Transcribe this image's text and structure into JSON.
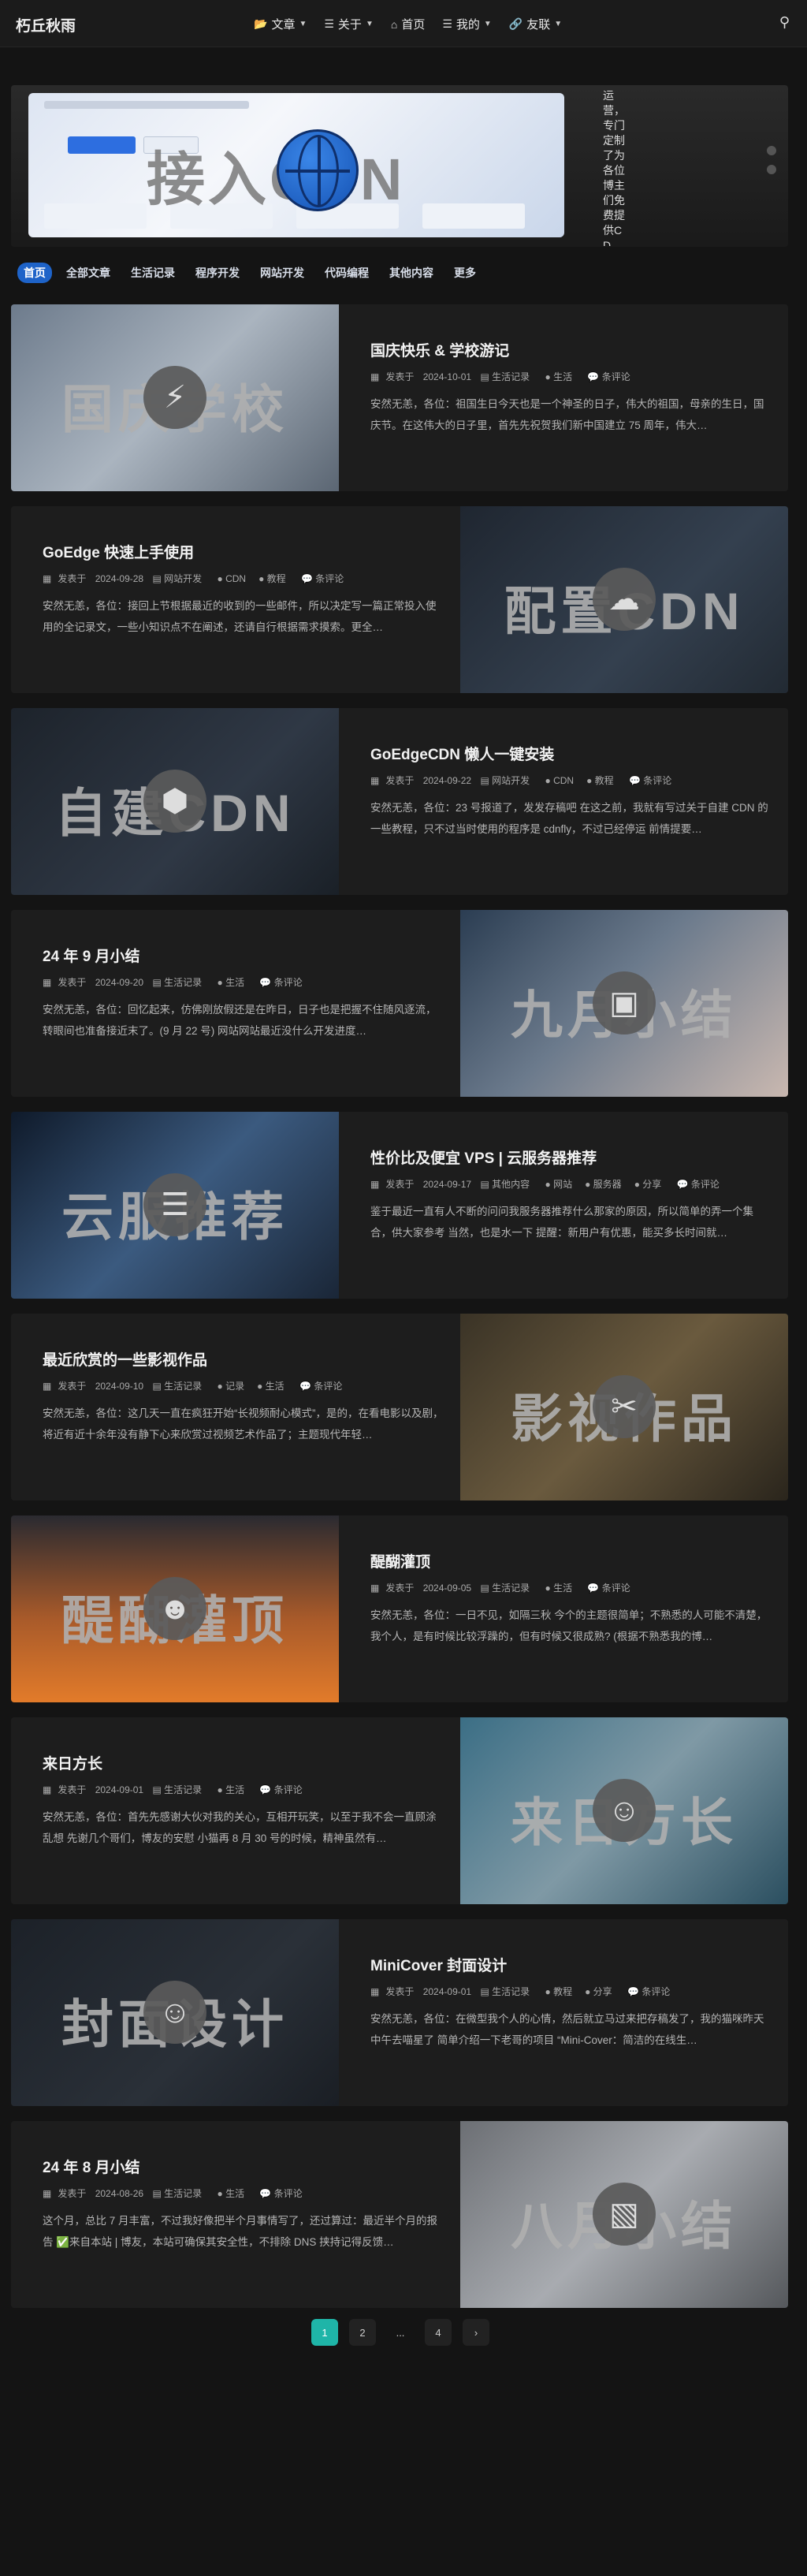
{
  "site": {
    "logo": "朽丘秋雨"
  },
  "nav": [
    {
      "label": "文章",
      "icon": "folder-icon",
      "has_dropdown": true
    },
    {
      "label": "关于",
      "icon": "list-icon",
      "has_dropdown": true
    },
    {
      "label": "首页",
      "icon": "home-icon",
      "has_dropdown": false
    },
    {
      "label": "我的",
      "icon": "list-icon",
      "has_dropdown": true
    },
    {
      "label": "友联",
      "icon": "link-icon",
      "has_dropdown": true
    }
  ],
  "hero": {
    "title": "接入CDN",
    "side_text": "运营，专门定制了为各位博主们免费提供CD"
  },
  "tabs": [
    "首页",
    "全部文章",
    "生活记录",
    "程序开发",
    "网站开发",
    "代码编程",
    "其他内容",
    "更多"
  ],
  "posts": [
    {
      "title": "国庆快乐 & 学校游记",
      "cover": "国庆学校",
      "icon": "lightning-icon",
      "date": "2024-10-01",
      "category": "生活记录",
      "tags": [
        "生活"
      ],
      "comments": "条评论",
      "excerpt": "安然无恙，各位：祖国生日今天也是一个神圣的日子，伟大的祖国，母亲的生日，国庆节。在这伟大的日子里，首先先祝贺我们新中国建立 75 周年，伟大…"
    },
    {
      "title": "GoEdge 快速上手使用",
      "cover": "配置CDN",
      "icon": "cloud-icon",
      "date": "2024-09-28",
      "category": "网站开发",
      "tags": [
        "CDN",
        "教程"
      ],
      "comments": "条评论",
      "excerpt": "安然无恙，各位：接回上节根据最近的收到的一些邮件，所以决定写一篇正常投入使用的全记录文，一些小知识点不在阐述，还请自行根据需求摸索。更全…"
    },
    {
      "title": "GoEdgeCDN 懒人一键安装",
      "cover": "自建CDN",
      "icon": "shield-icon",
      "date": "2024-09-22",
      "category": "网站开发",
      "tags": [
        "CDN",
        "教程"
      ],
      "comments": "条评论",
      "excerpt": "安然无恙，各位：23 号报道了，发发存稿吧 在这之前，我就有写过关于自建 CDN 的一些教程，只不过当时使用的程序是 cdnfly，不过已经停运 前情提要…"
    },
    {
      "title": "24 年 9 月小结",
      "cover": "九月小结",
      "icon": "calendar-icon",
      "date": "2024-09-20",
      "category": "生活记录",
      "tags": [
        "生活"
      ],
      "comments": "条评论",
      "excerpt": "安然无恙，各位：回忆起来，仿佛刚放假还是在昨日，日子也是把握不住随风逐流，转眼间也准备接近末了。(9 月 22 号) 网站网站最近没什么开发进度…"
    },
    {
      "title": "性价比及便宜 VPS | 云服务器推荐",
      "cover": "云服推荐",
      "icon": "server-icon",
      "date": "2024-09-17",
      "category": "其他内容",
      "tags": [
        "网站",
        "服务器",
        "分享"
      ],
      "comments": "条评论",
      "excerpt": "鉴于最近一直有人不断的问问我服务器推荐什么那家的原因，所以简单的弄一个集合，供大家参考 当然，也是水一下 提醒：新用户有优惠，能买多长时间就…"
    },
    {
      "title": "最近欣赏的一些影视作品",
      "cover": "影视作品",
      "icon": "clapper-icon",
      "date": "2024-09-10",
      "category": "生活记录",
      "tags": [
        "记录",
        "生活"
      ],
      "comments": "条评论",
      "excerpt": "安然无恙，各位：这几天一直在疯狂开始“长视频耐心模式”，是的，在看电影以及剧，将近有近十余年没有静下心来欣赏过视频艺术作品了；主题现代年轻…"
    },
    {
      "title": "醍醐灌顶",
      "cover": "醍醐灌顶",
      "icon": "meditation-icon",
      "date": "2024-09-05",
      "category": "生活记录",
      "tags": [
        "生活"
      ],
      "comments": "条评论",
      "excerpt": "安然无恙，各位：一日不见，如隔三秋 今个的主题很简单；不熟悉的人可能不清楚，我个人，是有时候比较浮躁的，但有时候又很成熟? (根据不熟悉我的博…"
    },
    {
      "title": "来日方长",
      "cover": "来日方长",
      "icon": "cat-icon",
      "date": "2024-09-01",
      "category": "生活记录",
      "tags": [
        "生活"
      ],
      "comments": "条评论",
      "excerpt": "安然无恙，各位：首先先感谢大伙对我的关心，互相开玩笑，以至于我不会一直顾涂乱想 先谢几个哥们，博友的安慰 小猫再 8 月 30 号的时候，精神虽然有…"
    },
    {
      "title": "MiniCover 封面设计",
      "cover": "封面设计",
      "icon": "avatar-icon",
      "date": "2024-09-01",
      "category": "生活记录",
      "tags": [
        "教程",
        "分享"
      ],
      "comments": "条评论",
      "excerpt": "安然无恙，各位：在微型我个人的心情，然后就立马过来把存稿发了，我的猫咪昨天中午去喵星了 简单介绍一下老哥的项目 “Mini-Cover：简洁的在线生…"
    },
    {
      "title": "24 年 8 月小结",
      "cover": "八月小结",
      "icon": "photo-icon",
      "date": "2024-08-26",
      "category": "生活记录",
      "tags": [
        "生活"
      ],
      "comments": "条评论",
      "excerpt": "这个月，总比 7 月丰富，不过我好像把半个月事情写了，还过算过：最近半个月的报告 ✅来自本站 | 博友，本站可确保其安全性，不排除 DNS 挟持记得反馈…"
    }
  ],
  "meta_labels": {
    "published": "发表于"
  },
  "pagination": [
    "1",
    "2",
    "...",
    "4",
    "›"
  ]
}
